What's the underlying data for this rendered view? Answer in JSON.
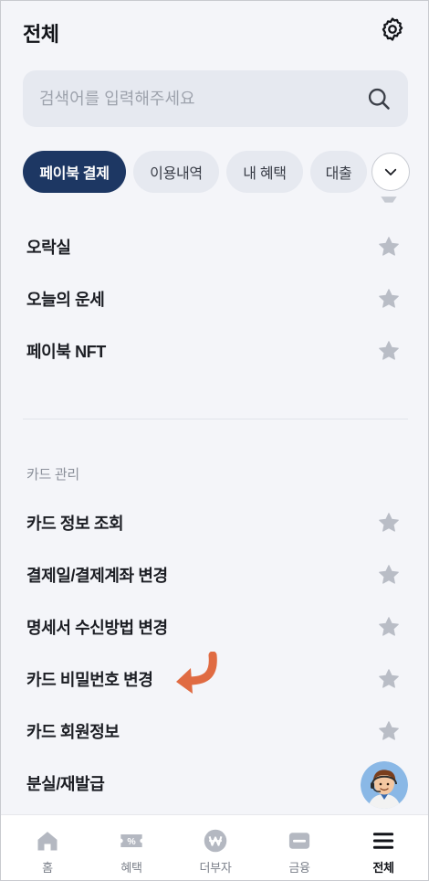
{
  "header": {
    "title": "전체",
    "settings_icon": "gear-icon"
  },
  "search": {
    "placeholder": "검색어를 입력해주세요",
    "value": ""
  },
  "chips": [
    {
      "label": "페이북 결제",
      "active": true
    },
    {
      "label": "이용내역",
      "active": false
    },
    {
      "label": "내 혜택",
      "active": false
    },
    {
      "label": "대출",
      "active": false
    }
  ],
  "menu": {
    "top_items": [
      {
        "label": "오락실"
      },
      {
        "label": "오늘의 운세"
      },
      {
        "label": "페이북 NFT"
      }
    ],
    "card_section": {
      "title": "카드 관리",
      "items": [
        {
          "label": "카드 정보 조회"
        },
        {
          "label": "결제일/결제계좌 변경"
        },
        {
          "label": "명세서 수신방법 변경"
        },
        {
          "label": "카드 비밀번호 변경"
        },
        {
          "label": "카드 회원정보"
        },
        {
          "label": "분실/재발급"
        }
      ]
    }
  },
  "tabbar": [
    {
      "label": "홈",
      "icon": "home-icon",
      "active": false
    },
    {
      "label": "혜택",
      "icon": "coupon-icon",
      "active": false
    },
    {
      "label": "더부자",
      "icon": "won-coin-icon",
      "active": false
    },
    {
      "label": "금융",
      "icon": "card-icon",
      "active": false
    },
    {
      "label": "전체",
      "icon": "menu-icon",
      "active": true
    }
  ],
  "colors": {
    "background": "#f4f5f9",
    "chip_active": "#1d3763",
    "chip_inactive": "#e6e9f0",
    "star": "#b9bdc6",
    "arrow": "#e06b42"
  }
}
